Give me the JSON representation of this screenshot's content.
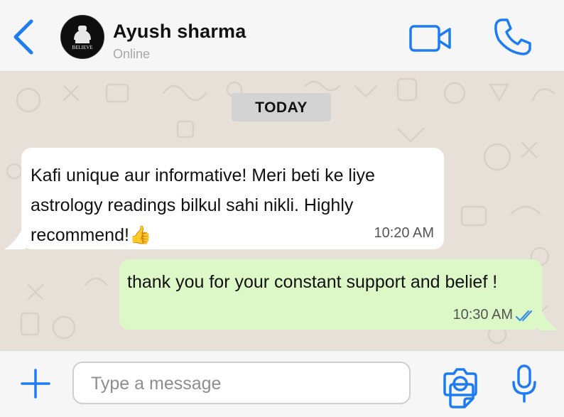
{
  "header": {
    "contact_name": "Ayush sharma",
    "status": "Online",
    "avatar_text": "BELIEVE"
  },
  "chat": {
    "date_label": "TODAY",
    "messages": [
      {
        "direction": "incoming",
        "text": "Kafi unique aur informative! Meri beti ke liye astrology readings bilkul sahi nikli. Highly recommend!👍",
        "time": "10:20 AM"
      },
      {
        "direction": "outgoing",
        "text": "thank you for your constant support and belief !",
        "time": "10:30 AM",
        "read": true
      }
    ]
  },
  "composer": {
    "placeholder": "Type a message",
    "value": ""
  },
  "icons": {
    "back": "chevron-left-icon",
    "video": "video-camera-icon",
    "call": "phone-icon",
    "add": "plus-icon",
    "sticker": "sticker-icon",
    "camera": "camera-icon",
    "mic": "microphone-icon"
  },
  "colors": {
    "accent": "#1e7cf2",
    "chat_bg": "#e6e0d9",
    "outgoing_bubble": "#dcf8c6",
    "incoming_bubble": "#ffffff",
    "read_ticks": "#3a8ee6"
  }
}
